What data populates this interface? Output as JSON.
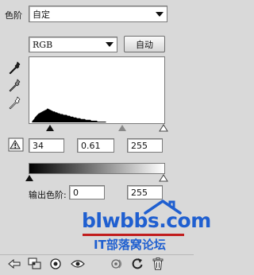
{
  "preset": {
    "label": "色阶",
    "value": "自定"
  },
  "channel": {
    "value": "RGB"
  },
  "auto_button": {
    "label": "自动"
  },
  "histogram": {
    "profile": [
      0,
      0,
      0,
      0,
      2,
      3,
      4,
      6,
      7,
      8,
      9,
      10,
      11,
      11,
      12,
      12,
      13,
      13,
      14,
      14,
      15,
      15,
      16,
      17,
      16,
      16,
      15,
      15,
      14,
      14,
      13,
      13,
      13,
      12,
      12,
      12,
      11,
      11,
      11,
      10,
      10,
      10,
      10,
      9,
      9,
      9,
      9,
      9,
      8,
      8,
      8,
      8,
      7,
      7,
      7,
      7,
      6,
      6,
      6,
      6,
      5,
      5,
      5,
      5,
      5,
      4,
      4,
      4,
      4,
      4,
      4,
      3,
      3,
      3,
      3,
      3,
      3,
      3,
      2,
      2,
      2,
      2,
      2,
      2,
      2,
      2,
      1,
      1,
      1,
      1,
      1,
      1,
      1,
      1,
      1,
      1,
      1,
      0,
      0,
      0,
      0,
      0,
      0,
      0,
      0,
      0,
      0,
      0,
      0,
      0,
      0,
      0,
      0,
      0,
      0,
      0,
      0,
      0,
      0,
      0,
      0,
      0,
      0,
      0,
      0,
      0,
      0,
      0,
      0,
      0,
      0,
      0,
      0,
      0,
      0,
      0,
      0,
      0,
      0,
      0,
      0,
      0,
      0,
      0,
      0,
      0,
      0,
      0,
      0,
      0,
      0,
      0,
      0,
      0,
      0,
      0,
      0,
      0,
      0,
      0,
      0,
      0,
      0,
      0,
      0,
      0,
      0,
      0
    ]
  },
  "input_levels": {
    "black": "34",
    "gamma": "0.61",
    "white": "255"
  },
  "output_levels": {
    "label": "输出色阶:",
    "black": "0",
    "white": "255"
  },
  "watermark": {
    "domain": "blwbbs.com",
    "tagline": "IT部落窝论坛"
  },
  "colors": {
    "watermark_blue": "#1f5fd0",
    "watermark_red": "#c11d1d"
  },
  "icons": [
    "eyedropper-black-icon",
    "eyedropper-gray-icon",
    "eyedropper-white-icon",
    "clipping-warning-icon",
    "adjustment-return-icon",
    "clip-to-layer-icon",
    "visibility-eye-icon",
    "view-previous-state-icon",
    "reset-icon",
    "trash-icon"
  ]
}
